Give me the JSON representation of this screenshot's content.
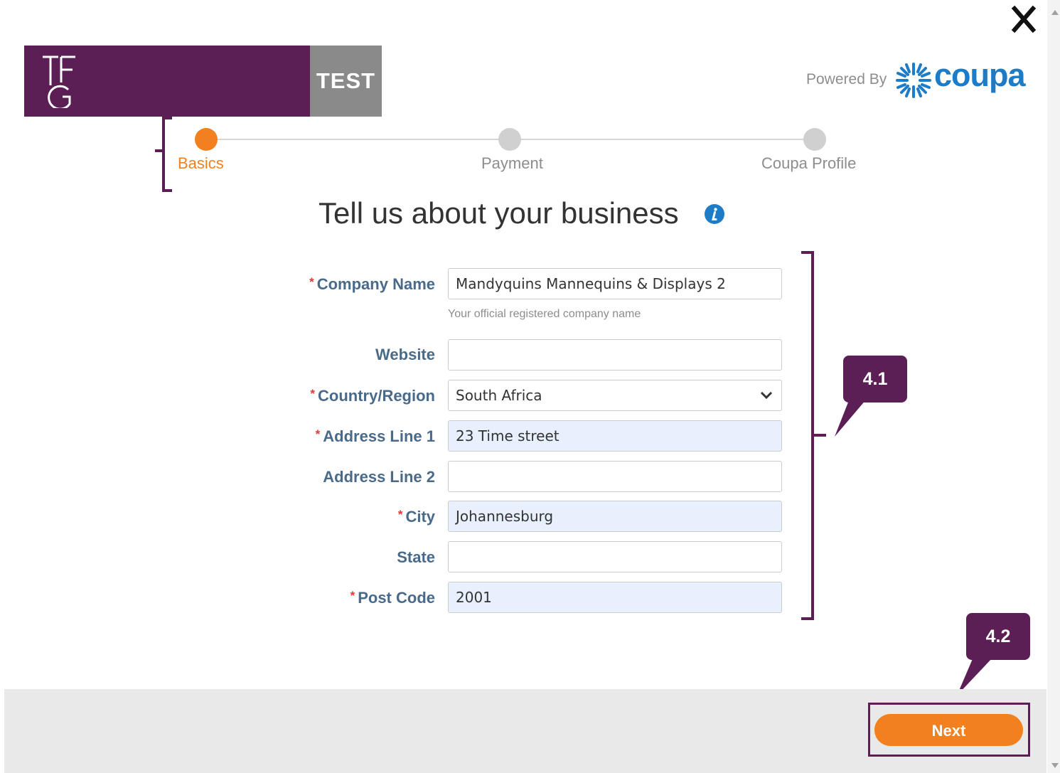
{
  "header": {
    "logo_tag": "TEST",
    "powered_by": "Powered By",
    "coupa_wordmark": "coupa"
  },
  "stepper": {
    "steps": [
      {
        "label": "Basics",
        "active": true
      },
      {
        "label": "Payment",
        "active": false
      },
      {
        "label": "Coupa Profile",
        "active": false
      }
    ]
  },
  "page_title": "Tell us about your business",
  "form": {
    "company_name": {
      "label": "Company Name",
      "required": true,
      "value": "Mandyquins Mannequins & Displays 2",
      "hint": "Your official registered company name"
    },
    "website": {
      "label": "Website",
      "required": false,
      "value": ""
    },
    "country": {
      "label": "Country/Region",
      "required": true,
      "value": "South Africa"
    },
    "address1": {
      "label": "Address Line 1",
      "required": true,
      "value": "23 Time street"
    },
    "address2": {
      "label": "Address Line 2",
      "required": false,
      "value": ""
    },
    "city": {
      "label": "City",
      "required": true,
      "value": "Johannesburg"
    },
    "state": {
      "label": "State",
      "required": false,
      "value": ""
    },
    "post_code": {
      "label": "Post Code",
      "required": true,
      "value": "2001"
    }
  },
  "required_mark": "*",
  "footer": {
    "next_label": "Next"
  },
  "callouts": {
    "form": "4.1",
    "next": "4.2"
  },
  "colors": {
    "accent_orange": "#f3801f",
    "brand_purple": "#5b1e55",
    "coupa_blue": "#1d7cc8",
    "label_blue": "#4a6a8a"
  }
}
